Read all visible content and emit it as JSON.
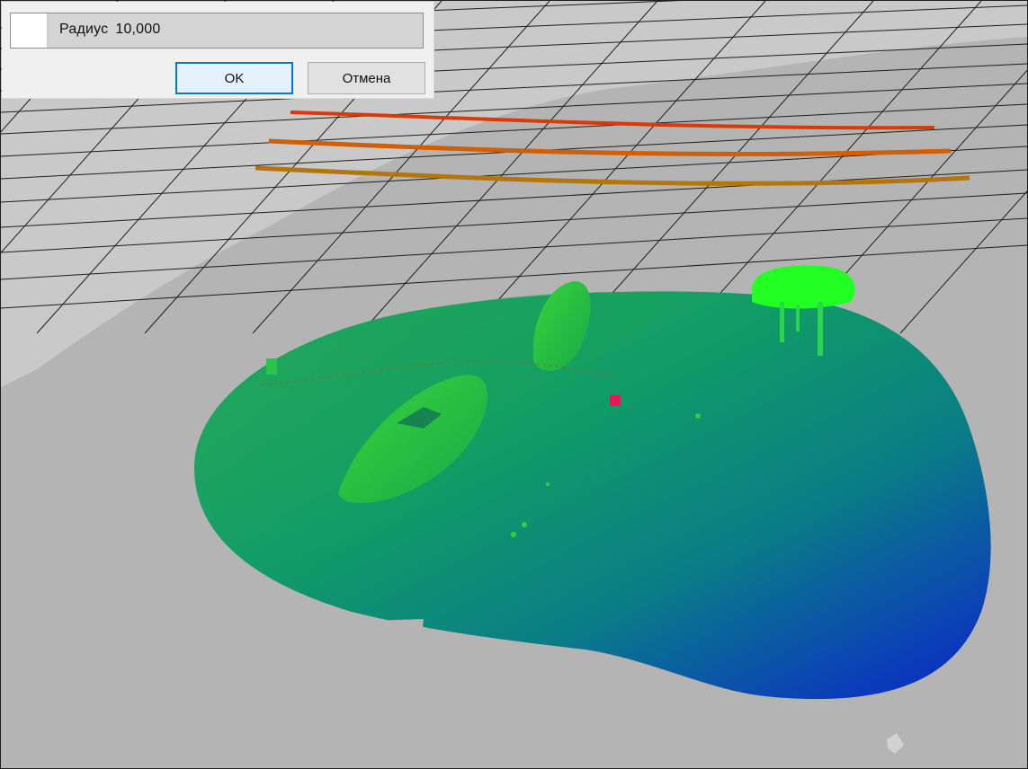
{
  "dialog": {
    "radius_label": "Радиус",
    "radius_value": "10,000",
    "ok_label": "OK",
    "cancel_label": "Отмена",
    "accent_color": "#0078d7"
  },
  "scene": {
    "background_color": "#b4b4b4",
    "ground_color": "#c9c9c9",
    "grid_color": "#1e1e1e",
    "cursor_marker_color": "#e8175d",
    "point_cloud_colors": [
      "#22ff22",
      "#109a60",
      "#0028c8"
    ],
    "profile_line_colors": [
      "#d93a08",
      "#d15f08",
      "#b5750a"
    ]
  }
}
